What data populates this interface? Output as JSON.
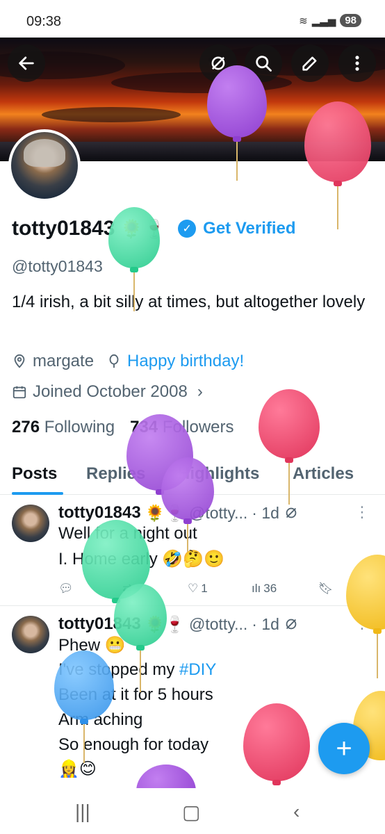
{
  "status": {
    "time": "09:38",
    "battery": "98"
  },
  "profile": {
    "name": "totty01843",
    "name_emojis": "🌻🍷",
    "get_verified": "Get Verified",
    "handle": "@totty01843",
    "bio": "1/4 irish, a bit silly at times, but altogether lovely",
    "location": "margate",
    "birthday": "Happy birthday!",
    "joined": "Joined October 2008",
    "following_count": "276",
    "following_label": "Following",
    "followers_count": "734",
    "followers_label": "Followers"
  },
  "tabs": [
    "Posts",
    "Replies",
    "Highlights",
    "Articles"
  ],
  "posts": [
    {
      "name": "totty01843",
      "emojis": "🌻🍷",
      "handle": "@totty...",
      "time": "· 1d",
      "lines": [
        "Well for a night out",
        "I. Home early 🤣🤔🙂"
      ],
      "likes": "1",
      "views": "36"
    },
    {
      "name": "totty01843",
      "emojis": "🌻🍷",
      "handle": "@totty...",
      "time": "· 1d",
      "line1": "Phew 😬",
      "line2_prefix": "I've stopped my ",
      "line2_tag": "#DIY",
      "line3": "Been at it for 5 hours",
      "line4": "Arm aching",
      "line5": "So enough for today",
      "line6": "👷‍♀️😊"
    }
  ],
  "colors": {
    "accent": "#1d9bf0",
    "text": "#0f1419",
    "muted": "#536471"
  },
  "icons": [
    "back-arrow-icon",
    "sync-off-icon",
    "search-icon",
    "edit-icon",
    "more-vertical-icon",
    "location-icon",
    "balloon-icon",
    "calendar-icon",
    "chevron-right-icon",
    "reply-icon",
    "repost-icon",
    "like-icon",
    "views-icon",
    "bookmark-icon",
    "share-icon",
    "plus-icon"
  ]
}
